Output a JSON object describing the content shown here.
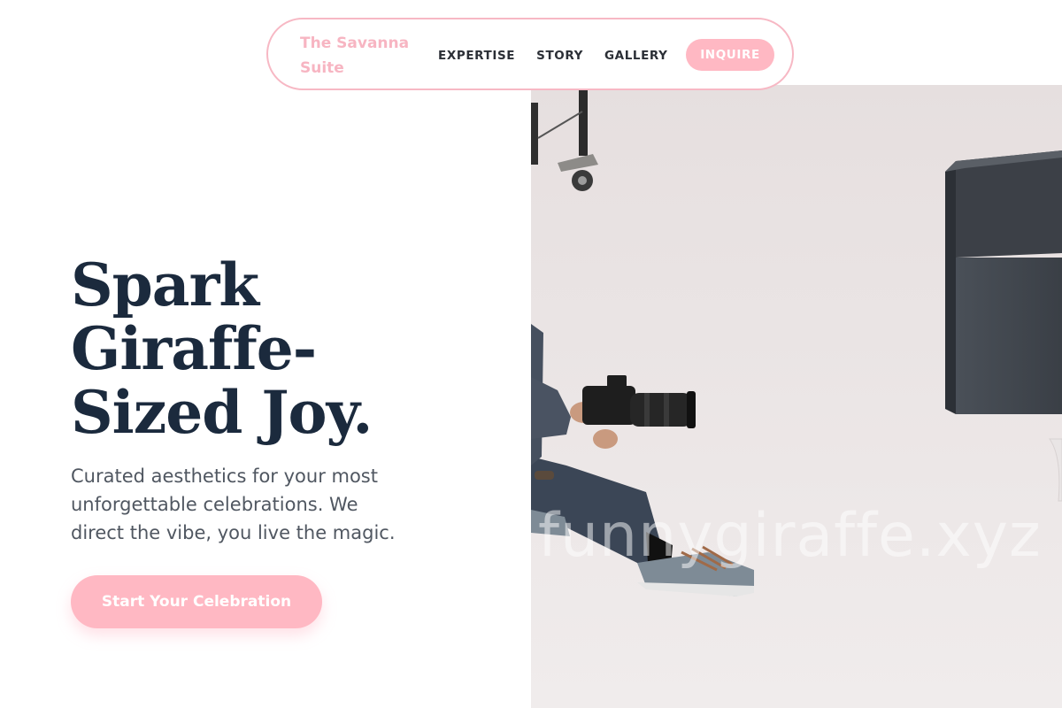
{
  "nav": {
    "brand": "The Savanna Suite",
    "links": [
      {
        "label": "EXPERTISE"
      },
      {
        "label": "STORY"
      },
      {
        "label": "GALLERY"
      }
    ],
    "cta_label": "INQUIRE"
  },
  "hero": {
    "title_lines": [
      "Spark",
      "Giraffe-",
      "Sized Joy."
    ],
    "subtitle_lines": [
      "Curated aesthetics for your most",
      "unforgettable celebrations. We",
      "direct the vibe, you live the magic."
    ],
    "cta_label": "Start Your Celebration"
  },
  "photo": {
    "watermark": "funnygiraffe.xyz",
    "description_icon": "photographer-photo"
  },
  "colors": {
    "accent_pink": "#ffb8c3",
    "brand_pink": "#f7b5c2",
    "heading_navy": "#1b2a3d",
    "body_gray": "#505761"
  }
}
